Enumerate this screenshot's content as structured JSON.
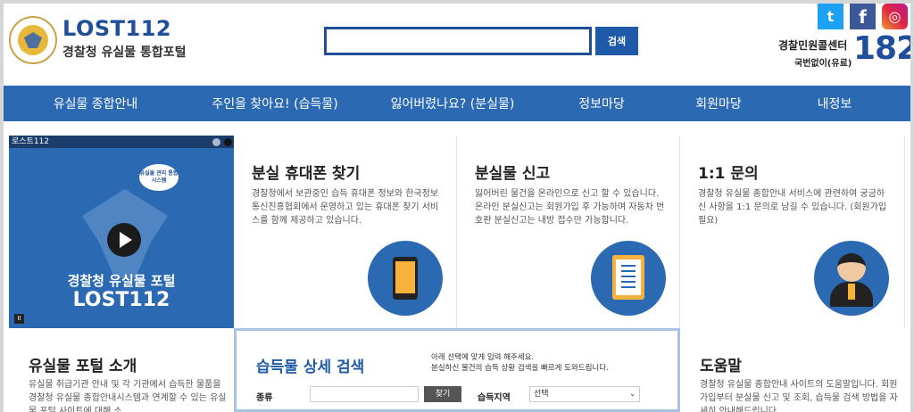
{
  "header": {
    "brand_title": "LOST112",
    "brand_subtitle": "경찰청 유실물 통합포털",
    "search_button": "검색",
    "call_center_label": "경찰민원콜센터",
    "call_center_sub": "국번없이(유료)",
    "call_center_number": "182",
    "social": [
      "twitter-icon",
      "facebook-icon",
      "instagram-icon"
    ]
  },
  "nav": {
    "items": [
      "유실물 종합안내",
      "주인을 찾아요! (습득물)",
      "잃어버렸나요? (분실물)",
      "정보마당",
      "회원마당",
      "내정보"
    ]
  },
  "video": {
    "top_label": "로스트112",
    "bubble_text": "유실물 관리 통합 시스템",
    "title_line1": "경찰청 유실물 포털",
    "title_line2": "LOST112"
  },
  "services": [
    {
      "title": "분실 휴대폰 찾기",
      "desc": "경찰청에서 보관중인 습득 휴대폰 정보와 한국정보통신진흥협회에서 운영하고 있는 휴대폰 찾기 서비스를 함께 제공하고 있습니다."
    },
    {
      "title": "분실물 신고",
      "desc": "잃어버린 물건을 온라인으로 신고 할 수 있습니다. 온라인 분실신고는 회원가입 후 가능하며 자동차 번호판 분실신고는 내방 접수만 가능합니다."
    },
    {
      "title": "1:1 문의",
      "desc": "경찰청 유실물 종합안내 서비스에 관련하여 궁금하신 사항을 1:1 문의로 남길 수 있습니다. (회원가입 필요)"
    }
  ],
  "intro": {
    "title": "유실물 포털 소개",
    "desc": "유실물 취급기관 안내 및 각 기관에서 습득한 물품을 경찰청 유실물 종합안내시스템과 연계할 수 있는 유실물 포털 사이트에 대해 소"
  },
  "detail_search": {
    "title": "습득물 상세 검색",
    "guide_line1": "아래 선택에 맞게 입력 해주세요.",
    "guide_line2": "분실하신 물건의 습득 상황 검색을 빠르게 도와드립니다.",
    "kind_label": "종류",
    "find_button": "찾기",
    "area_label": "습득지역",
    "area_value": "선택"
  },
  "help": {
    "title": "도움말",
    "desc": "경찰청 유실물 종합안내 사이트의 도움말입니다. 회원가입부터 분실물 신고 및 조회, 습득물 검색 방법을 자세히 안내해드립니다."
  }
}
